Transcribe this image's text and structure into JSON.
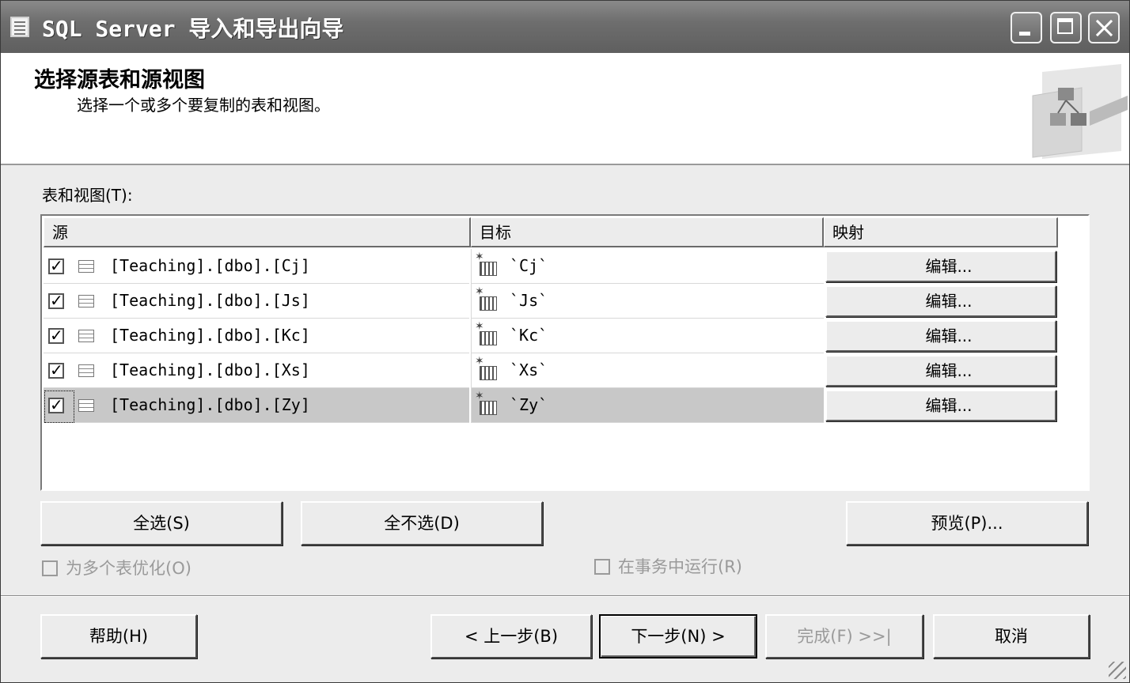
{
  "window": {
    "title": "SQL Server 导入和导出向导"
  },
  "header": {
    "title": "选择源表和源视图",
    "subtitle": "选择一个或多个要复制的表和视图。"
  },
  "tables_section": {
    "label": "表和视图(T):",
    "columns": [
      "源",
      "目标",
      "映射"
    ],
    "rows": [
      {
        "checked": true,
        "source": "[Teaching].[dbo].[Cj]",
        "target": "`Cj`",
        "mapping": "编辑..."
      },
      {
        "checked": true,
        "source": "[Teaching].[dbo].[Js]",
        "target": "`Js`",
        "mapping": "编辑..."
      },
      {
        "checked": true,
        "source": "[Teaching].[dbo].[Kc]",
        "target": "`Kc`",
        "mapping": "编辑..."
      },
      {
        "checked": true,
        "source": "[Teaching].[dbo].[Xs]",
        "target": "`Xs`",
        "mapping": "编辑..."
      },
      {
        "checked": true,
        "source": "[Teaching].[dbo].[Zy]",
        "target": "`Zy`",
        "mapping": "编辑...",
        "selected": true
      }
    ]
  },
  "buttons": {
    "select_all": "全选(S)",
    "select_none": "全不选(D)",
    "preview": "预览(P)...",
    "help": "帮助(H)",
    "back": "< 上一步(B)",
    "next": "下一步(N) >",
    "finish": "完成(F) >>|",
    "cancel": "取消"
  },
  "options": {
    "optimize_multi_table": {
      "label": "为多个表优化(O)",
      "checked": false,
      "enabled": false
    },
    "run_in_transaction": {
      "label": "在事务中运行(R)",
      "checked": false,
      "enabled": false
    }
  }
}
